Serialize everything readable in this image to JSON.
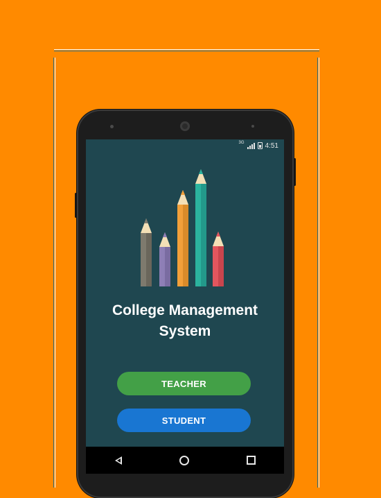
{
  "app": {
    "title_line1": "College Management",
    "title_line2": "System"
  },
  "status_bar": {
    "network": "3G",
    "time": "4:51"
  },
  "buttons": {
    "teacher": "TEACHER",
    "student": "STUDENT"
  },
  "navigation": {
    "back": "back-icon",
    "home": "home-icon",
    "recent": "recent-apps-icon"
  },
  "colors": {
    "background": "#FF8A00",
    "screen": "#1F4750",
    "teacher_button": "#43A047",
    "student_button": "#1976D2",
    "pencils": [
      "#7E7A6E",
      "#8E7FB6",
      "#F2A03A",
      "#2BB39E",
      "#E2565E"
    ]
  }
}
